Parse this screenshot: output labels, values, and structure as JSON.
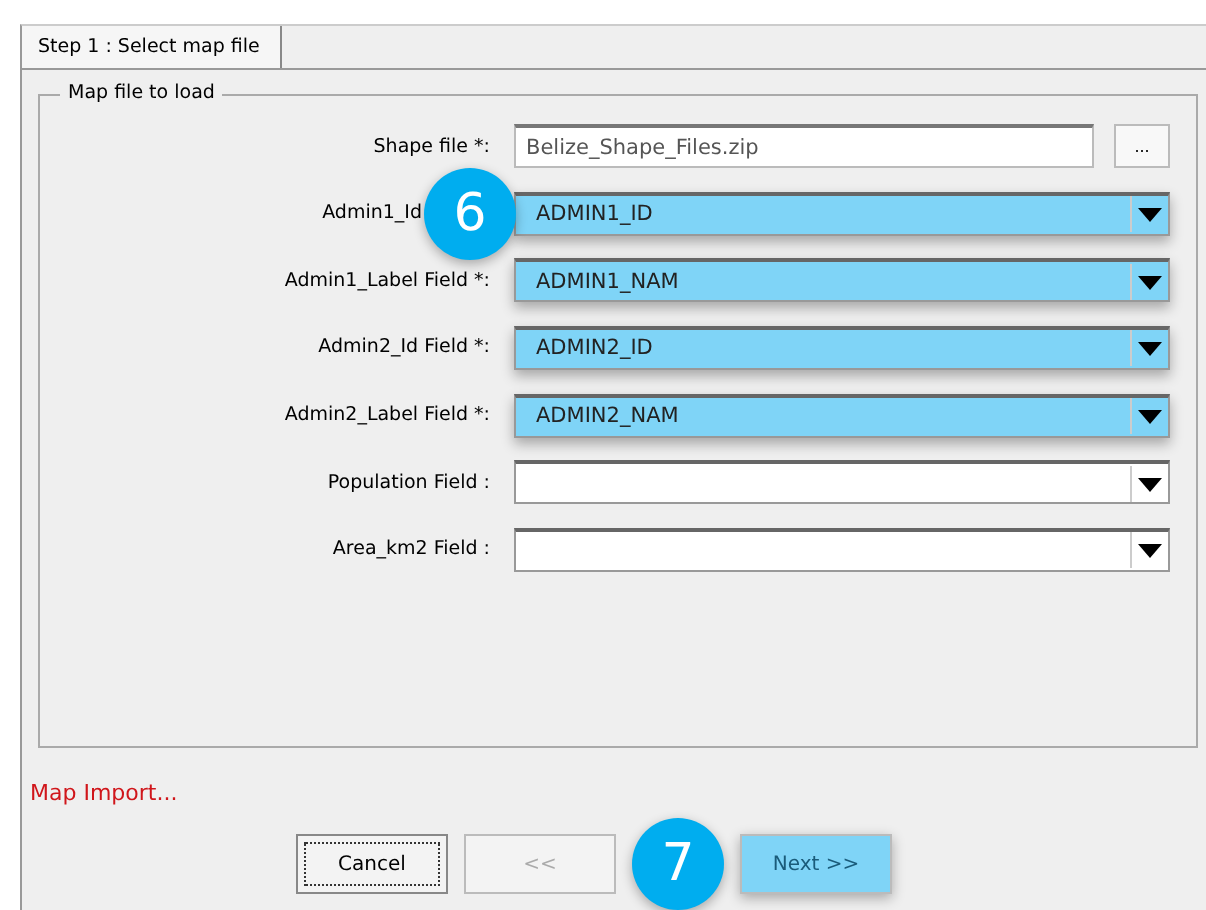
{
  "tabs": [
    {
      "label": "Step 1 : Select map file",
      "selected": true
    }
  ],
  "group": {
    "title": "Map file to load",
    "shape_file": {
      "label": "Shape file *:",
      "value": "Belize_Shape_Files.zip",
      "browse": "..."
    },
    "fields": [
      {
        "label": "Admin1_Id",
        "value": "ADMIN1_ID",
        "highlighted": true,
        "callout": "6"
      },
      {
        "label": "Admin1_Label Field *:",
        "value": "ADMIN1_NAM",
        "highlighted": true
      },
      {
        "label": "Admin2_Id Field *:",
        "value": "ADMIN2_ID",
        "highlighted": true
      },
      {
        "label": "Admin2_Label Field *:",
        "value": "ADMIN2_NAM",
        "highlighted": true
      },
      {
        "label": "Population Field :",
        "highlighted": false
      },
      {
        "label": "Area_km2 Field :",
        "highlighted": false
      }
    ]
  },
  "status": "Map Import...",
  "buttons": [
    {
      "label": "Cancel",
      "focused": true,
      "disabled": false,
      "highlighted": false
    },
    {
      "label": "<<",
      "focused": false,
      "disabled": true,
      "highlighted": false
    },
    {
      "label": "Next >>",
      "focused": false,
      "disabled": false,
      "highlighted": true,
      "callout": "7"
    }
  ]
}
